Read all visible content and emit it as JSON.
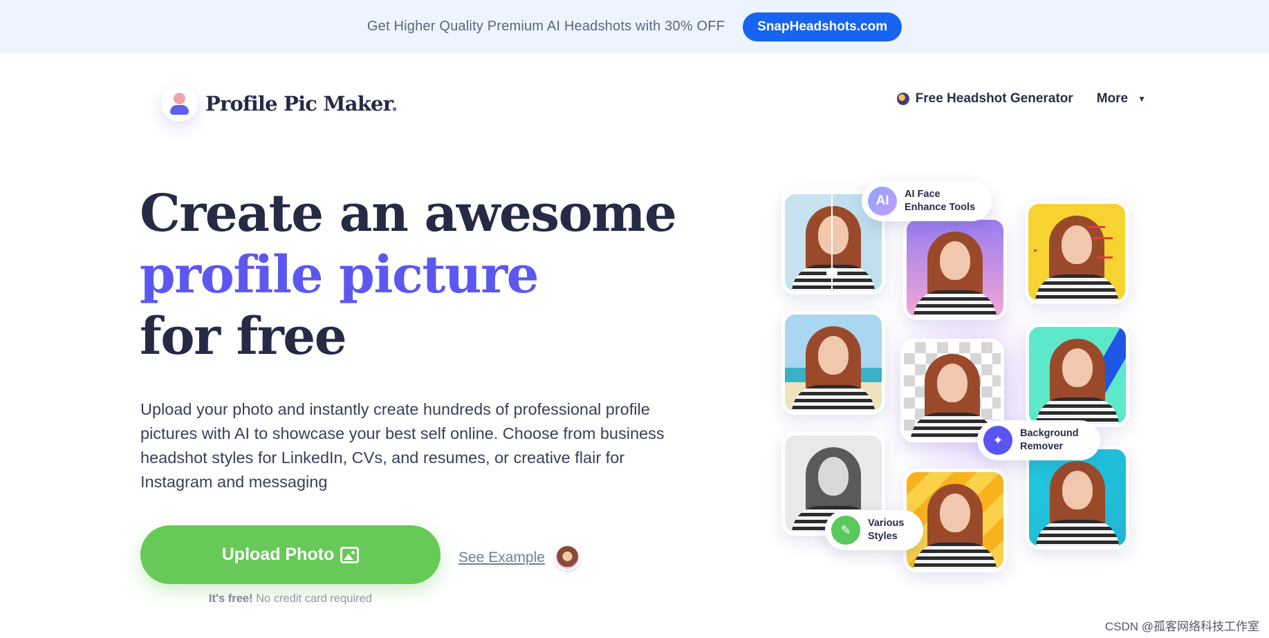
{
  "promo": {
    "text": "Get Higher Quality Premium AI Headshots with 30% OFF",
    "button": "SnapHeadshots.com"
  },
  "header": {
    "logo_text": "Profile Pic Maker",
    "logo_dot": ".",
    "nav": {
      "headshot_link": "Free Headshot Generator",
      "more": "More",
      "more_caret": "▼"
    }
  },
  "hero": {
    "title_line1": "Create an awesome",
    "title_line2": "profile picture",
    "title_line3": "for free",
    "description": "Upload your photo and instantly create hundreds of professional profile pictures with AI to showcase your best self online. Choose from business headshot styles for LinkedIn, CVs, and resumes, or creative flair for Instagram and messaging",
    "upload_button": "Upload Photo",
    "see_example": "See Example",
    "free_note_bold": "It's free!",
    "free_note_rest": "No credit card required"
  },
  "collage": {
    "badge_ai_icon": "AI",
    "badge_ai": "AI Face Enhance Tools",
    "badge_bg": "Background Remover",
    "badge_bg_icon": "✦",
    "badge_styles": "Various Styles",
    "badge_styles_icon": "✎"
  },
  "watermark": "CSDN @孤客网络科技工作室",
  "colors": {
    "accent": "#5c58ef",
    "upload_green": "#67c957",
    "promo_blue": "#1764f0"
  }
}
